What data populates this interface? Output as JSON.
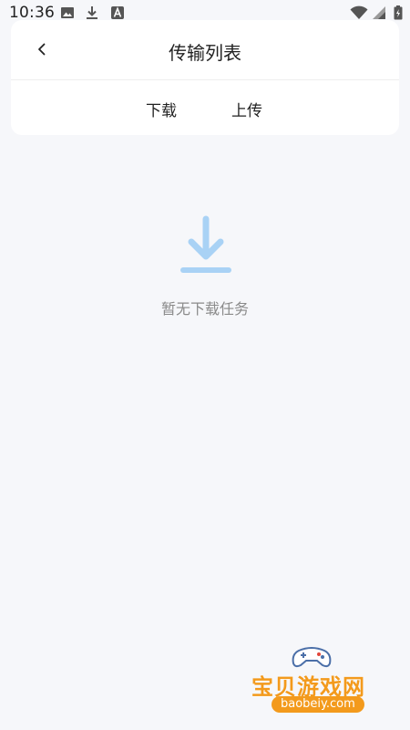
{
  "status_bar": {
    "time": "10:36",
    "left_icons": [
      "image-icon",
      "download-icon",
      "font-a-icon"
    ],
    "right_icons": [
      "wifi-icon",
      "signal-icon",
      "battery-icon"
    ]
  },
  "header": {
    "back_icon": "back-chevron-icon",
    "title": "传输列表",
    "tabs": [
      {
        "label": "下载",
        "active": true
      },
      {
        "label": "上传",
        "active": false
      }
    ]
  },
  "empty_state": {
    "icon": "download-icon",
    "text": "暂无下载任务"
  },
  "watermark": {
    "logo": "gamepad-icon",
    "title": "宝贝游戏网",
    "url": "baobeiy.com"
  },
  "colors": {
    "background": "#f6f7fa",
    "card": "#ffffff",
    "empty_icon": "#a9d2f5",
    "empty_text": "#8a8a8a",
    "watermark": "#f39a1c"
  }
}
